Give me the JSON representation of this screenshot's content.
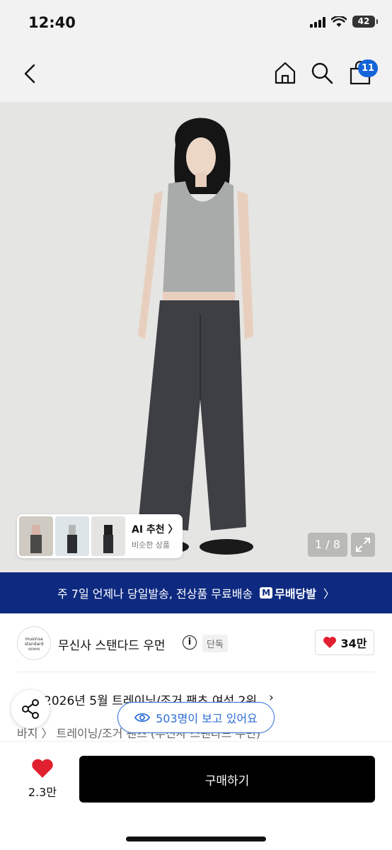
{
  "status_bar": {
    "time": "12:40",
    "battery": "42"
  },
  "nav": {
    "cart_count": "11"
  },
  "product_image": {
    "ai_title": "AI 추천 〉",
    "ai_subtitle": "비슷한 상품",
    "counter": "1 / 8"
  },
  "banner": {
    "text": "주 7일 언제나 당일발송, 전상품 무료배송",
    "badge_icon": "M",
    "badge_label": "무배당발",
    "chevron": "〉"
  },
  "brand": {
    "logo_line1": "musinsa",
    "logo_line2": "standard",
    "logo_line3": "WOMAN",
    "name": "무신사 스탠다드 우먼",
    "info": "i",
    "badge": "단독",
    "likes": "34만"
  },
  "product": {
    "title": "2026년 5월 트레이닝/조거 팬츠 여성 2위",
    "breadcrumb": "바지 〉 트레이닝/조거 팬츠 (무신사 스탠다드 우먼)",
    "viewers": "503명이 보고 있어요"
  },
  "bottom": {
    "likes": "2.3만",
    "buy_label": "구매하기"
  },
  "colors": {
    "accent": "#1565d8",
    "banner_bg": "#0e2a80",
    "heart": "#e0202e",
    "buy_bg": "#000000"
  }
}
